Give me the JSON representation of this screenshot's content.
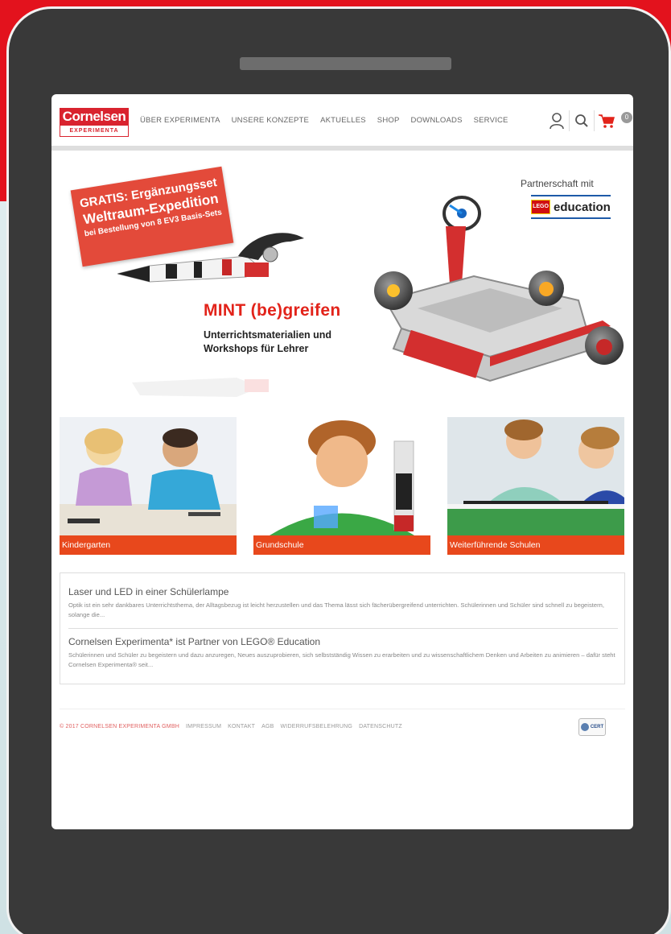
{
  "site": {
    "logo_main": "Cornelsen",
    "logo_sub": "EXPERIMENTA"
  },
  "nav": {
    "items": [
      "ÜBER EXPERIMENTA",
      "UNSERE KONZEPTE",
      "AKTUELLES",
      "SHOP",
      "DOWNLOADS",
      "SERVICE"
    ]
  },
  "header_icons": {
    "user": "user-icon",
    "search": "search-icon",
    "cart": "cart-icon",
    "cart_count": "0"
  },
  "hero": {
    "promo_line1": "GRATIS: Ergänzungsset",
    "promo_line2": "Weltraum-Expedition",
    "promo_line3": "bei Bestellung von 8 EV3 Basis-Sets",
    "title": "MINT (be)greifen",
    "subtitle": "Unterrichtsmaterialien und Workshops für Lehrer",
    "partner_label": "Partnerschaft mit",
    "partner_logo_text": "LEGO",
    "partner_name": "education"
  },
  "tiles": [
    {
      "label": "Kindergarten"
    },
    {
      "label": "Grundschule"
    },
    {
      "label": "Weiterführende Schulen"
    }
  ],
  "news": [
    {
      "title": "Laser und LED in einer Schülerlampe",
      "text": "Optik ist ein sehr dankbares Unterrichtsthema, der Alltagsbezug ist leicht herzustellen und das Thema lässt sich fächerübergreifend unterrichten. Schülerinnen und Schüler sind schnell zu begeistern, solange die..."
    },
    {
      "title": "Cornelsen Experimenta* ist Partner von LEGO® Education",
      "text": "Schülerinnen und Schüler zu begeistern und dazu anzuregen, Neues auszuprobieren, sich selbstständig Wissen zu erarbeiten und zu wissenschaftlichem Denken und Arbeiten zu animieren – dafür steht Cornelsen Experimenta® seit..."
    }
  ],
  "footer": {
    "copyright": "© 2017 CORNELSEN EXPERIMENTA GMBH",
    "links": [
      "IMPRESSUM",
      "KONTAKT",
      "AGB",
      "WIDERRUFSBELEHRUNG",
      "DATENSCHUTZ"
    ],
    "cert": "CERT"
  },
  "colors": {
    "brand_red": "#d9232e",
    "tile_orange": "#e8481c",
    "tablet_frame": "#393939"
  }
}
